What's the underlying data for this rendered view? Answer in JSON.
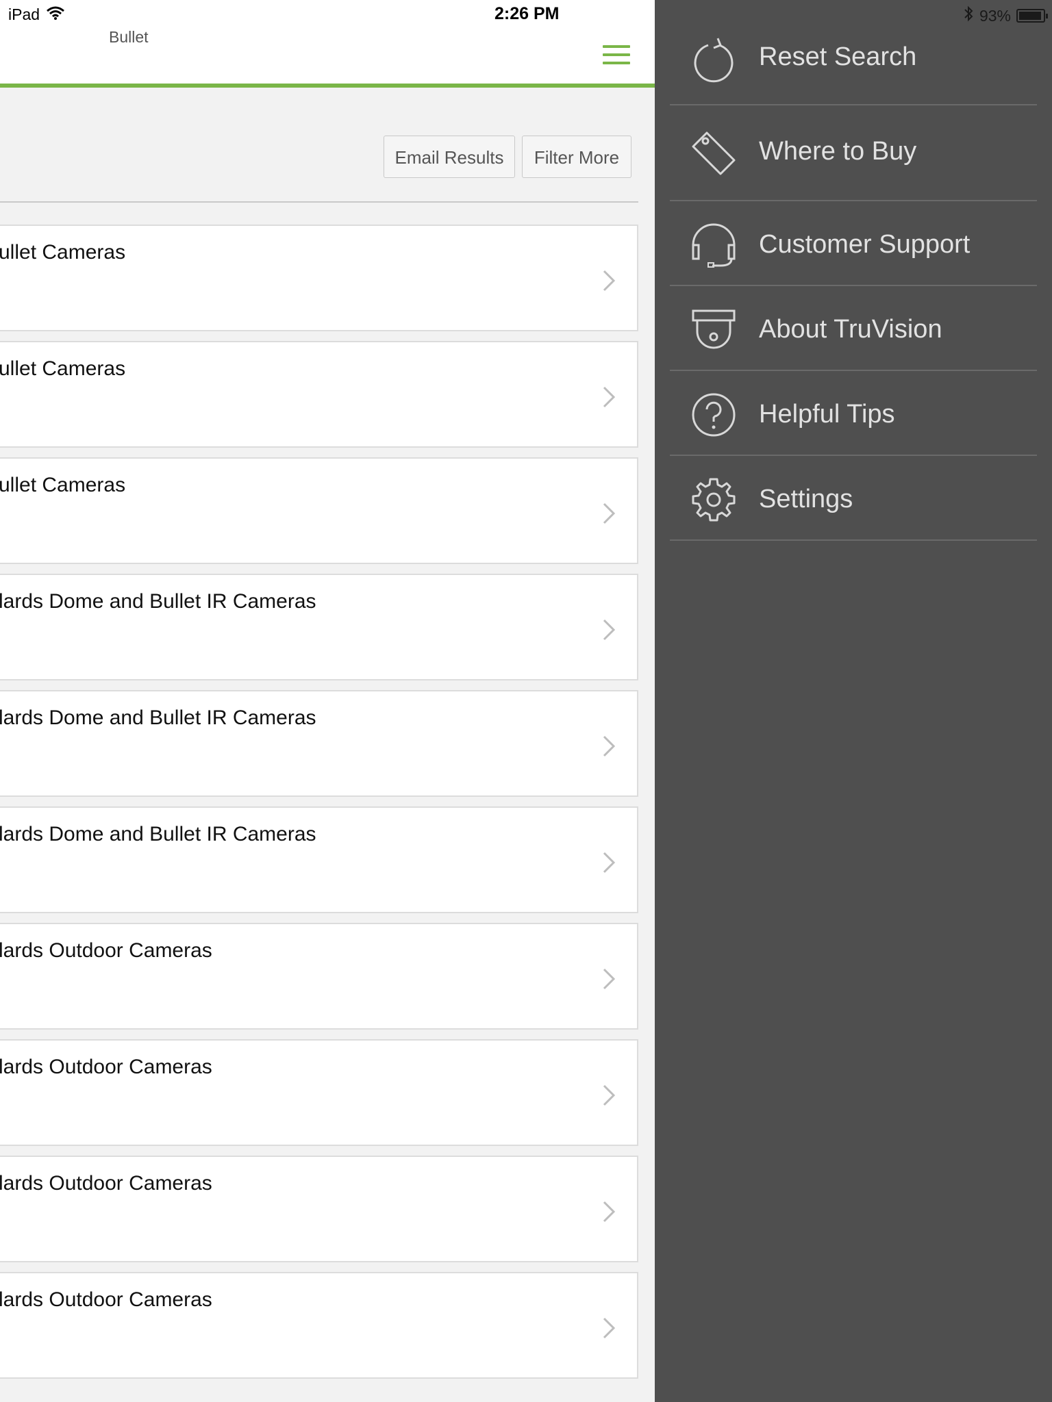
{
  "status_bar": {
    "device": "iPad",
    "time": "2:26 PM",
    "battery_text": "93%",
    "battery_level": 0.93,
    "wifi_icon": "wifi-icon",
    "bluetooth_icon": "bluetooth-icon"
  },
  "nav": {
    "title": "Bullet",
    "menu_icon": "hamburger-icon",
    "accent_color": "#7ab648"
  },
  "actions": {
    "email_label": "Email Results",
    "filter_label": "Filter More"
  },
  "results": [
    {
      "title": "ullet Cameras"
    },
    {
      "title": "ullet Cameras"
    },
    {
      "title": "ullet Cameras"
    },
    {
      "title": "lards Dome and Bullet IR Cameras"
    },
    {
      "title": "lards Dome and Bullet IR Cameras"
    },
    {
      "title": "lards Dome and Bullet IR Cameras"
    },
    {
      "title": "lards Outdoor Cameras"
    },
    {
      "title": "lards Outdoor Cameras"
    },
    {
      "title": "lards Outdoor Cameras"
    },
    {
      "title": "lards Outdoor Cameras"
    }
  ],
  "drawer": {
    "background": "#4f4f4f",
    "items": [
      {
        "label": "Reset Search",
        "icon": "refresh-icon"
      },
      {
        "label": "Where to Buy",
        "icon": "tag-icon"
      },
      {
        "label": "Customer Support",
        "icon": "headset-icon"
      },
      {
        "label": "About TruVision",
        "icon": "dome-camera-icon"
      },
      {
        "label": "Helpful Tips",
        "icon": "question-icon"
      },
      {
        "label": "Settings",
        "icon": "gear-icon"
      }
    ]
  }
}
